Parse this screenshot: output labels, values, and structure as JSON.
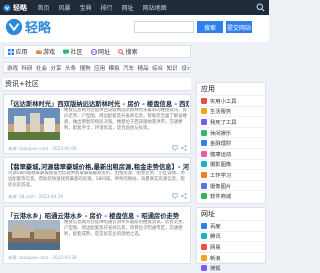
{
  "topbar": {
    "brand": "轻略",
    "nav": [
      "首页",
      "风暴",
      "宝典",
      "排行",
      "网址",
      "网站地图"
    ]
  },
  "header": {
    "logo_text": "轻略",
    "search_button": "搜索",
    "submit_button": "提交网站"
  },
  "tabs": [
    {
      "label": "应用",
      "icon": "grid-icon"
    },
    {
      "label": "游戏",
      "icon": "gamepad-icon"
    },
    {
      "label": "社区",
      "icon": "chat-icon"
    },
    {
      "label": "网址",
      "icon": "link-icon"
    },
    {
      "label": "搜索",
      "icon": "search-icon"
    }
  ],
  "tags": [
    "游戏",
    "科研",
    "社会",
    "分享",
    "头条",
    "搜狗",
    "应用",
    "模拟",
    "汽车",
    "精品",
    "综合",
    "知识",
    "设计"
  ],
  "section_title": "资讯+社区",
  "articles": [
    {
      "title": "「远达斯林时光」西双版纳远达斯林时光 - 房价 - 楼盘信息 - 西双版纳房价走势",
      "desc": "楼盘信息网为您提供西双版纳远达斯林时光最新的楼盘资讯、房价走势、户型图、周边配套及开发商信息，帮助您全面了解该楼盘，做出明智的购房决策。楼盘位于西双版纳景洪市，交通便利，配套齐全，环境优美，适合居住与投资。",
      "meta": "来源: zxloupan.com · 2023-05-06",
      "thumb_colors": [
        "#6b8fb8",
        "#c9a57b"
      ]
    },
    {
      "title": "【翡翠豪城,河源翡翠豪城价格,最新出租房源,租金走势信息】- 河源58同城",
      "desc": "河源58同城翡翠豪城频道为您提供翡翠豪城最新房价、出租房源、租金走势、小区详情、周边配套等信息，帮助您快速找到满意的房源。58同城，神奇的网站，海量真实房源信息，租房买房首选。",
      "meta": "来源: 58.com · 2023-04-19",
      "thumb_colors": []
    },
    {
      "title": "「云港水乡」昭通云港水乡 - 房价 - 楼盘信息 - 昭通房价走势",
      "desc": "楼盘信息网为您提供昭通云港水乡最新的楼盘资讯、房价走势、户型图、周边配套及开发商信息，项目位于昭通市区，交通便利，配套成熟，是宜居宜业的理想之选。",
      "meta": "来源: zxloupan.com · 2023-03-28",
      "thumb_colors": [
        "#8a6a4e",
        "#c4b59a"
      ]
    }
  ],
  "sidebar": {
    "apps_title": "应用",
    "apps": [
      {
        "label": "实用小工具",
        "color": "#ef4b4b"
      },
      {
        "label": "生活服务",
        "color": "#f4a31a"
      },
      {
        "label": "我死了工具",
        "color": "#7a5cf0"
      },
      {
        "label": "休闲娱乐",
        "color": "#2eb872"
      },
      {
        "label": "金融理财",
        "color": "#2f80ed"
      },
      {
        "label": "健康运动",
        "color": "#e85aa5"
      },
      {
        "label": "摄影图像",
        "color": "#19b3c8"
      },
      {
        "label": "工作学习",
        "color": "#f07a2e"
      },
      {
        "label": "摄像图片",
        "color": "#5b6ff0"
      },
      {
        "label": "软件商城",
        "color": "#3ab54a"
      }
    ],
    "sites_title": "网址",
    "sites": [
      {
        "label": "百度",
        "color": "#2f80ed"
      },
      {
        "label": "腾讯",
        "color": "#19b3c8"
      },
      {
        "label": "网易",
        "color": "#ef4b4b"
      },
      {
        "label": "新浪",
        "color": "#f4a31a"
      },
      {
        "label": "搜狐",
        "color": "#7a5cf0"
      }
    ]
  }
}
